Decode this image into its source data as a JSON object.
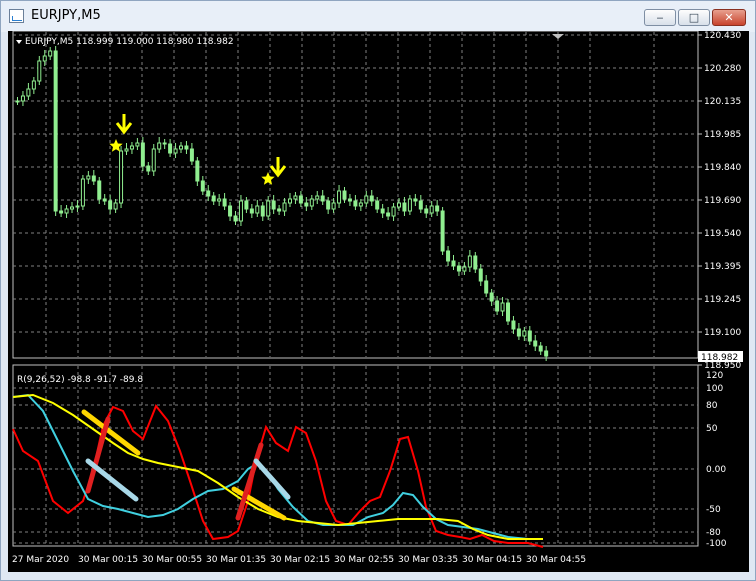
{
  "window": {
    "title": "EURJPY,M5",
    "min_symbol": "‒",
    "max_symbol": "□",
    "close_symbol": "✕"
  },
  "main_chart": {
    "header": "EURJPY,M5  118.999 119.000 118.980 118.982",
    "price_levels": [
      "120.430",
      "120.280",
      "120.135",
      "119.985",
      "119.840",
      "119.690",
      "119.540",
      "119.395",
      "119.245",
      "119.100",
      "118.950"
    ],
    "current_price": "118.982",
    "bar_color": "#90ee90",
    "signal_color": "#ffff00"
  },
  "indicator": {
    "header": "R(9,26,52) -98.8 -91.7 -89.8",
    "levels": [
      "120",
      "100",
      "80",
      "50",
      "0.00",
      "-50",
      "-80",
      "-100"
    ],
    "series_colors": [
      "#ff0000",
      "#40d0e0",
      "#ffff00"
    ],
    "values": [
      -98.8,
      -91.7,
      -89.8
    ]
  },
  "time_axis": {
    "labels": [
      "27 Mar 2020",
      "30 Mar 00:15",
      "30 Mar 00:55",
      "30 Mar 01:35",
      "30 Mar 02:15",
      "30 Mar 02:55",
      "30 Mar 03:35",
      "30 Mar 04:15",
      "30 Mar 04:55"
    ]
  }
}
